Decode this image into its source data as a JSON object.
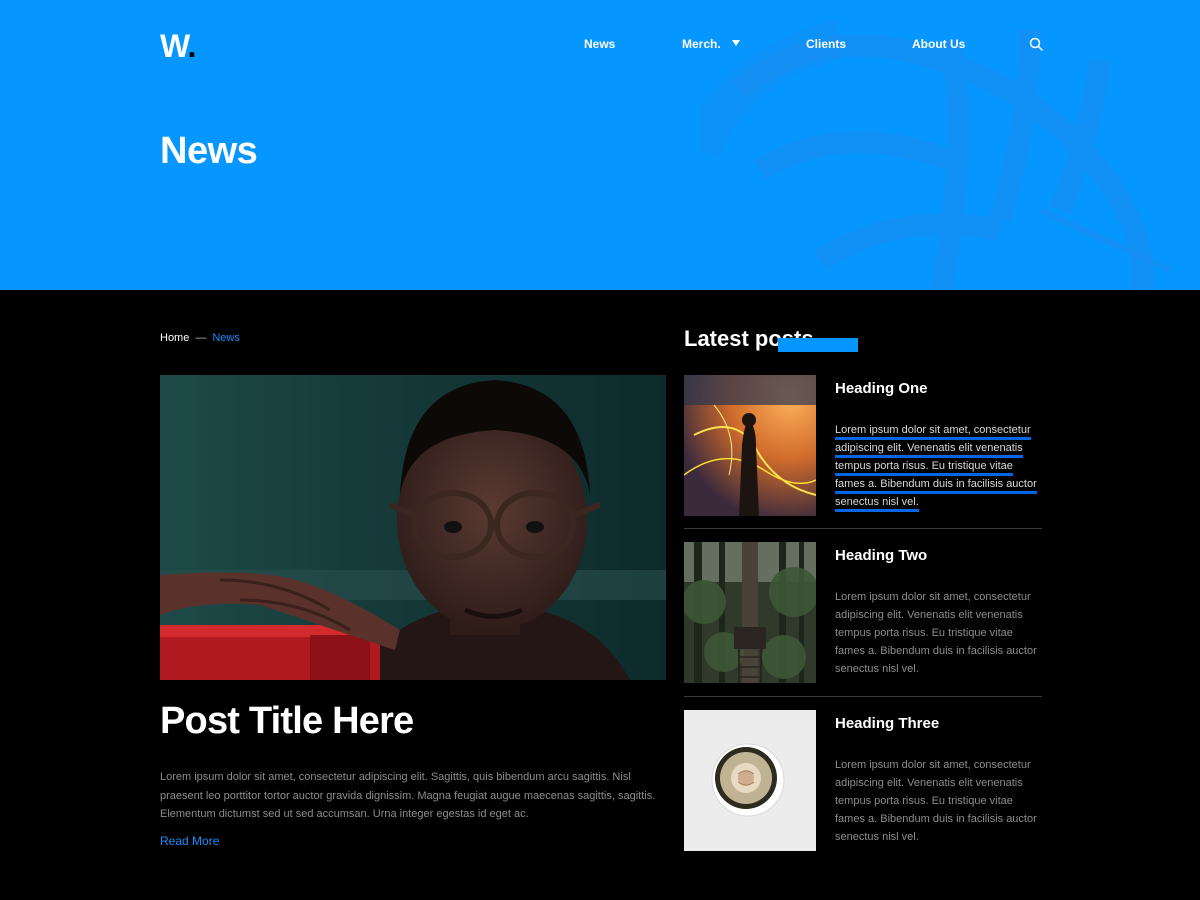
{
  "header": {
    "logo_text": "W",
    "logo_dot": ".",
    "nav": {
      "news": "News",
      "merch": "Merch.",
      "clients": "Clients",
      "about": "About Us"
    },
    "page_title": "News"
  },
  "breadcrumb": {
    "home": "Home",
    "separator": "—",
    "current": "News"
  },
  "featured_post": {
    "title": "Post Title Here",
    "excerpt": "Lorem ipsum dolor sit amet, consectetur adipiscing elit. Sagittis, quis bibendum arcu sagittis. Nisl praesent leo porttitor tortor auctor gravida dignissim. Magna feugiat augue maecenas sagittis, sagittis. Elementum dictumst sed ut sed accumsan. Urna integer egestas id eget ac.",
    "read_more": "Read More"
  },
  "sidebar": {
    "title": "Latest posts",
    "posts": [
      {
        "heading": "Heading One",
        "text": "Lorem ipsum dolor sit amet, consectetur adipiscing elit. Venenatis elit venenatis tempus porta risus. Eu tristique vitae fames a. Bibendum duis in facilisis auctor senectus nisl vel."
      },
      {
        "heading": "Heading Two",
        "text": "Lorem ipsum dolor sit amet, consectetur adipiscing elit. Venenatis elit venenatis tempus porta risus. Eu tristique vitae fames a. Bibendum duis in facilisis auctor senectus nisl vel."
      },
      {
        "heading": "Heading Three",
        "text": "Lorem ipsum dolor sit amet, consectetur adipiscing elit. Venenatis elit venenatis tempus porta risus. Eu tristique vitae fames a. Bibendum duis in facilisis auctor senectus nisl vel."
      }
    ]
  },
  "colors": {
    "accent": "#0597ff",
    "link": "#1a8cff",
    "background": "#000000",
    "muted_text": "#8d8d8d"
  },
  "icons": {
    "search": "search-icon",
    "dropdown": "chevron-down-icon"
  }
}
